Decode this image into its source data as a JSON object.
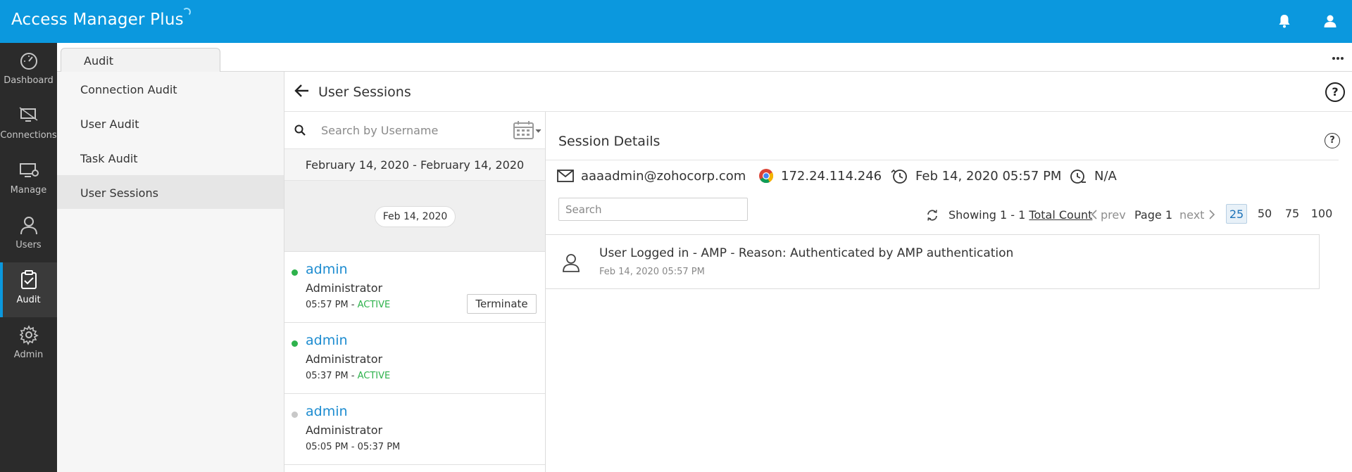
{
  "app": {
    "title": "Access Manager Plus"
  },
  "header": {
    "bell_icon": "bell-icon",
    "user_icon": "user-icon"
  },
  "nav": [
    {
      "label": "Dashboard",
      "icon": "dashboard-icon"
    },
    {
      "label": "Connections",
      "icon": "connections-icon"
    },
    {
      "label": "Manage",
      "icon": "manage-icon"
    },
    {
      "label": "Users",
      "icon": "users-icon"
    },
    {
      "label": "Audit",
      "icon": "audit-icon",
      "active": true
    },
    {
      "label": "Admin",
      "icon": "admin-icon"
    }
  ],
  "tab": {
    "label": "Audit",
    "more": "•••"
  },
  "submenu": [
    {
      "label": "Connection Audit"
    },
    {
      "label": "User Audit"
    },
    {
      "label": "Task Audit"
    },
    {
      "label": "User Sessions",
      "active": true
    }
  ],
  "page": {
    "title": "User Sessions",
    "help": "?"
  },
  "sessions": {
    "search_placeholder": "Search by Username",
    "date_range": "February 14, 2020 - February 14, 2020",
    "group_date": "Feb 14, 2020",
    "items": [
      {
        "user": "admin",
        "role": "Administrator",
        "time": "05:57 PM - ",
        "status": "ACTIVE",
        "dot_color": "#2eb24c",
        "terminate": "Terminate"
      },
      {
        "user": "admin",
        "role": "Administrator",
        "time": "05:37 PM - ",
        "status": "ACTIVE",
        "dot_color": "#2eb24c"
      },
      {
        "user": "admin",
        "role": "Administrator",
        "time": "05:05 PM - 05:37 PM",
        "status": "",
        "dot_color": "#c8c8c8"
      }
    ]
  },
  "details": {
    "title": "Session Details",
    "help": "?",
    "email": "aaaadmin@zohocorp.com",
    "ip": "172.24.114.246",
    "start": "Feb 14, 2020 05:57 PM",
    "end": "N/A",
    "search_placeholder": "Search",
    "pager": {
      "showing": "Showing 1 - 1",
      "total_label": "Total Count",
      "prev": "prev",
      "page": "Page 1",
      "next": "next",
      "sizes": [
        "25",
        "50",
        "75",
        "100"
      ],
      "selected_size": "25"
    },
    "logs": [
      {
        "text": "User Logged in - AMP - Reason: Authenticated by AMP authentication",
        "time": "Feb 14, 2020 05:57 PM"
      }
    ]
  },
  "colors": {
    "header": "#0b98de",
    "nav": "#2b2b2b",
    "active_status": "#2eb24c",
    "link": "#1d8cd0"
  }
}
